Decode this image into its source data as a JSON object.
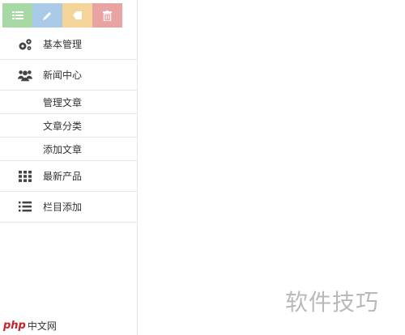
{
  "shortcuts": [
    {
      "icon": "list-icon",
      "color": "#a8d9a4"
    },
    {
      "icon": "pencil-icon",
      "color": "#aacbe8"
    },
    {
      "icon": "tag-icon",
      "color": "#f5d499"
    },
    {
      "icon": "trash-icon",
      "color": "#e9a3a3"
    }
  ],
  "menu": {
    "basic": {
      "label": "基本管理",
      "icon": "cogs-icon"
    },
    "news": {
      "label": "新闻中心",
      "icon": "users-icon"
    },
    "news_sub": [
      "管理文章",
      "文章分类",
      "添加文章"
    ],
    "products": {
      "label": "最新产品",
      "icon": "grid-icon"
    },
    "columns": {
      "label": "栏目添加",
      "icon": "list-icon"
    }
  },
  "watermark": "软件技巧",
  "logo": {
    "mark": "php",
    "text": "中文网"
  }
}
